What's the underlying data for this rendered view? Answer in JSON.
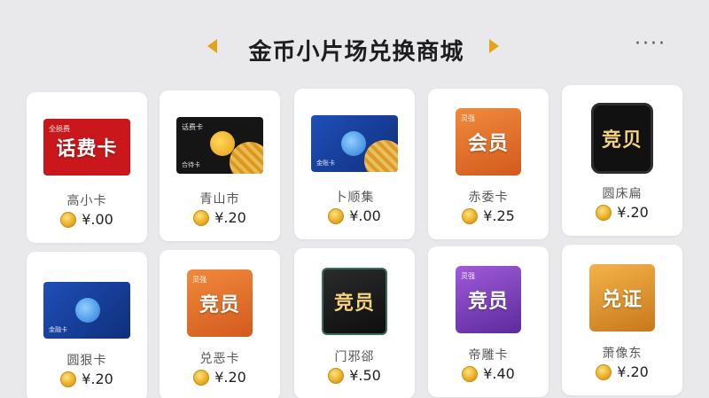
{
  "header": {
    "title": "金币小片场兑换商城",
    "more_label": "····"
  },
  "colors": {
    "accent": "#e3a319",
    "background": "#e9e9ec"
  },
  "items": [
    {
      "name": "高小卡",
      "price": "¥.00",
      "thumb_sub": "全损费",
      "thumb_main": "话费卡",
      "thumb_foot": "",
      "icon": "phone-bill-card-icon"
    },
    {
      "name": "青山市",
      "price": "¥.20",
      "thumb_sub": "话费卡",
      "thumb_main": "",
      "thumb_foot": "合待卡",
      "icon": "coin-card-icon"
    },
    {
      "name": "卜顺集",
      "price": "¥.00",
      "thumb_sub": "",
      "thumb_main": "",
      "thumb_foot": "金账卡",
      "icon": "blue-planet-card-icon"
    },
    {
      "name": "赤委卡",
      "price": "¥.25",
      "thumb_sub": "灵强",
      "thumb_main": "会员",
      "thumb_foot": "",
      "icon": "member-stamp-icon"
    },
    {
      "name": "圆床扁",
      "price": "¥.20",
      "thumb_sub": "",
      "thumb_main": "竞贝",
      "thumb_foot": "",
      "icon": "black-badge-icon"
    },
    {
      "name": "圆狠卡",
      "price": "¥.20",
      "thumb_sub": "",
      "thumb_main": "",
      "thumb_foot": "金融卡",
      "icon": "blue-planet-card-icon"
    },
    {
      "name": "兑恶卡",
      "price": "¥.20",
      "thumb_sub": "灵强",
      "thumb_main": "竞员",
      "thumb_foot": "",
      "icon": "orange-stamp-icon"
    },
    {
      "name": "门邪郤",
      "price": "¥.50",
      "thumb_sub": "",
      "thumb_main": "竞员",
      "thumb_foot": "",
      "icon": "dark-stamp-icon"
    },
    {
      "name": "帝雕卡",
      "price": "¥.40",
      "thumb_sub": "灵强",
      "thumb_main": "竞员",
      "thumb_foot": "",
      "icon": "purple-stamp-icon"
    },
    {
      "name": "萧像东",
      "price": "¥.20",
      "thumb_sub": "",
      "thumb_main": "兑证",
      "thumb_foot": "",
      "icon": "gold-stamp-icon"
    }
  ]
}
